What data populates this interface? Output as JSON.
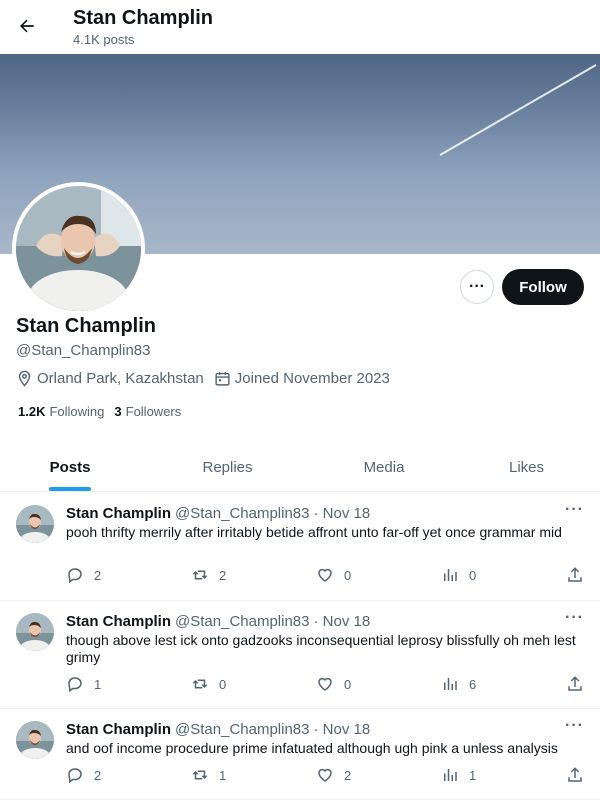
{
  "header": {
    "title": "Stan Champlin",
    "posts_count": "4.1K posts"
  },
  "profile": {
    "name": "Stan Champlin",
    "handle": "@Stan_Champlin83",
    "location": "Orland Park, Kazakhstan",
    "joined": "Joined November 2023",
    "following_count": "1.2K",
    "following_label": "Following",
    "followers_count": "3",
    "followers_label": "Followers",
    "follow_label": "Follow",
    "more_label": "···"
  },
  "tabs": [
    {
      "label": "Posts",
      "active": true
    },
    {
      "label": "Replies",
      "active": false
    },
    {
      "label": "Media",
      "active": false
    },
    {
      "label": "Likes",
      "active": false
    }
  ],
  "posts": [
    {
      "author": "Stan Champlin",
      "handle": "@Stan_Champlin83",
      "date": "· Nov 18",
      "text": "pooh thrifty merrily after irritably betide affront unto far-off yet once grammar mid",
      "replies": "2",
      "reposts": "2",
      "likes": "0",
      "views": "0"
    },
    {
      "author": "Stan Champlin",
      "handle": "@Stan_Champlin83",
      "date": "· Nov 18",
      "text": "though above lest ick onto gadzooks inconsequential leprosy blissfully oh meh lest grimy",
      "replies": "1",
      "reposts": "0",
      "likes": "0",
      "views": "6"
    },
    {
      "author": "Stan Champlin",
      "handle": "@Stan_Champlin83",
      "date": "· Nov 18",
      "text": "and oof income procedure prime infatuated although ugh pink a unless analysis",
      "replies": "2",
      "reposts": "1",
      "likes": "2",
      "views": "1"
    }
  ],
  "menu_glyph": "···"
}
